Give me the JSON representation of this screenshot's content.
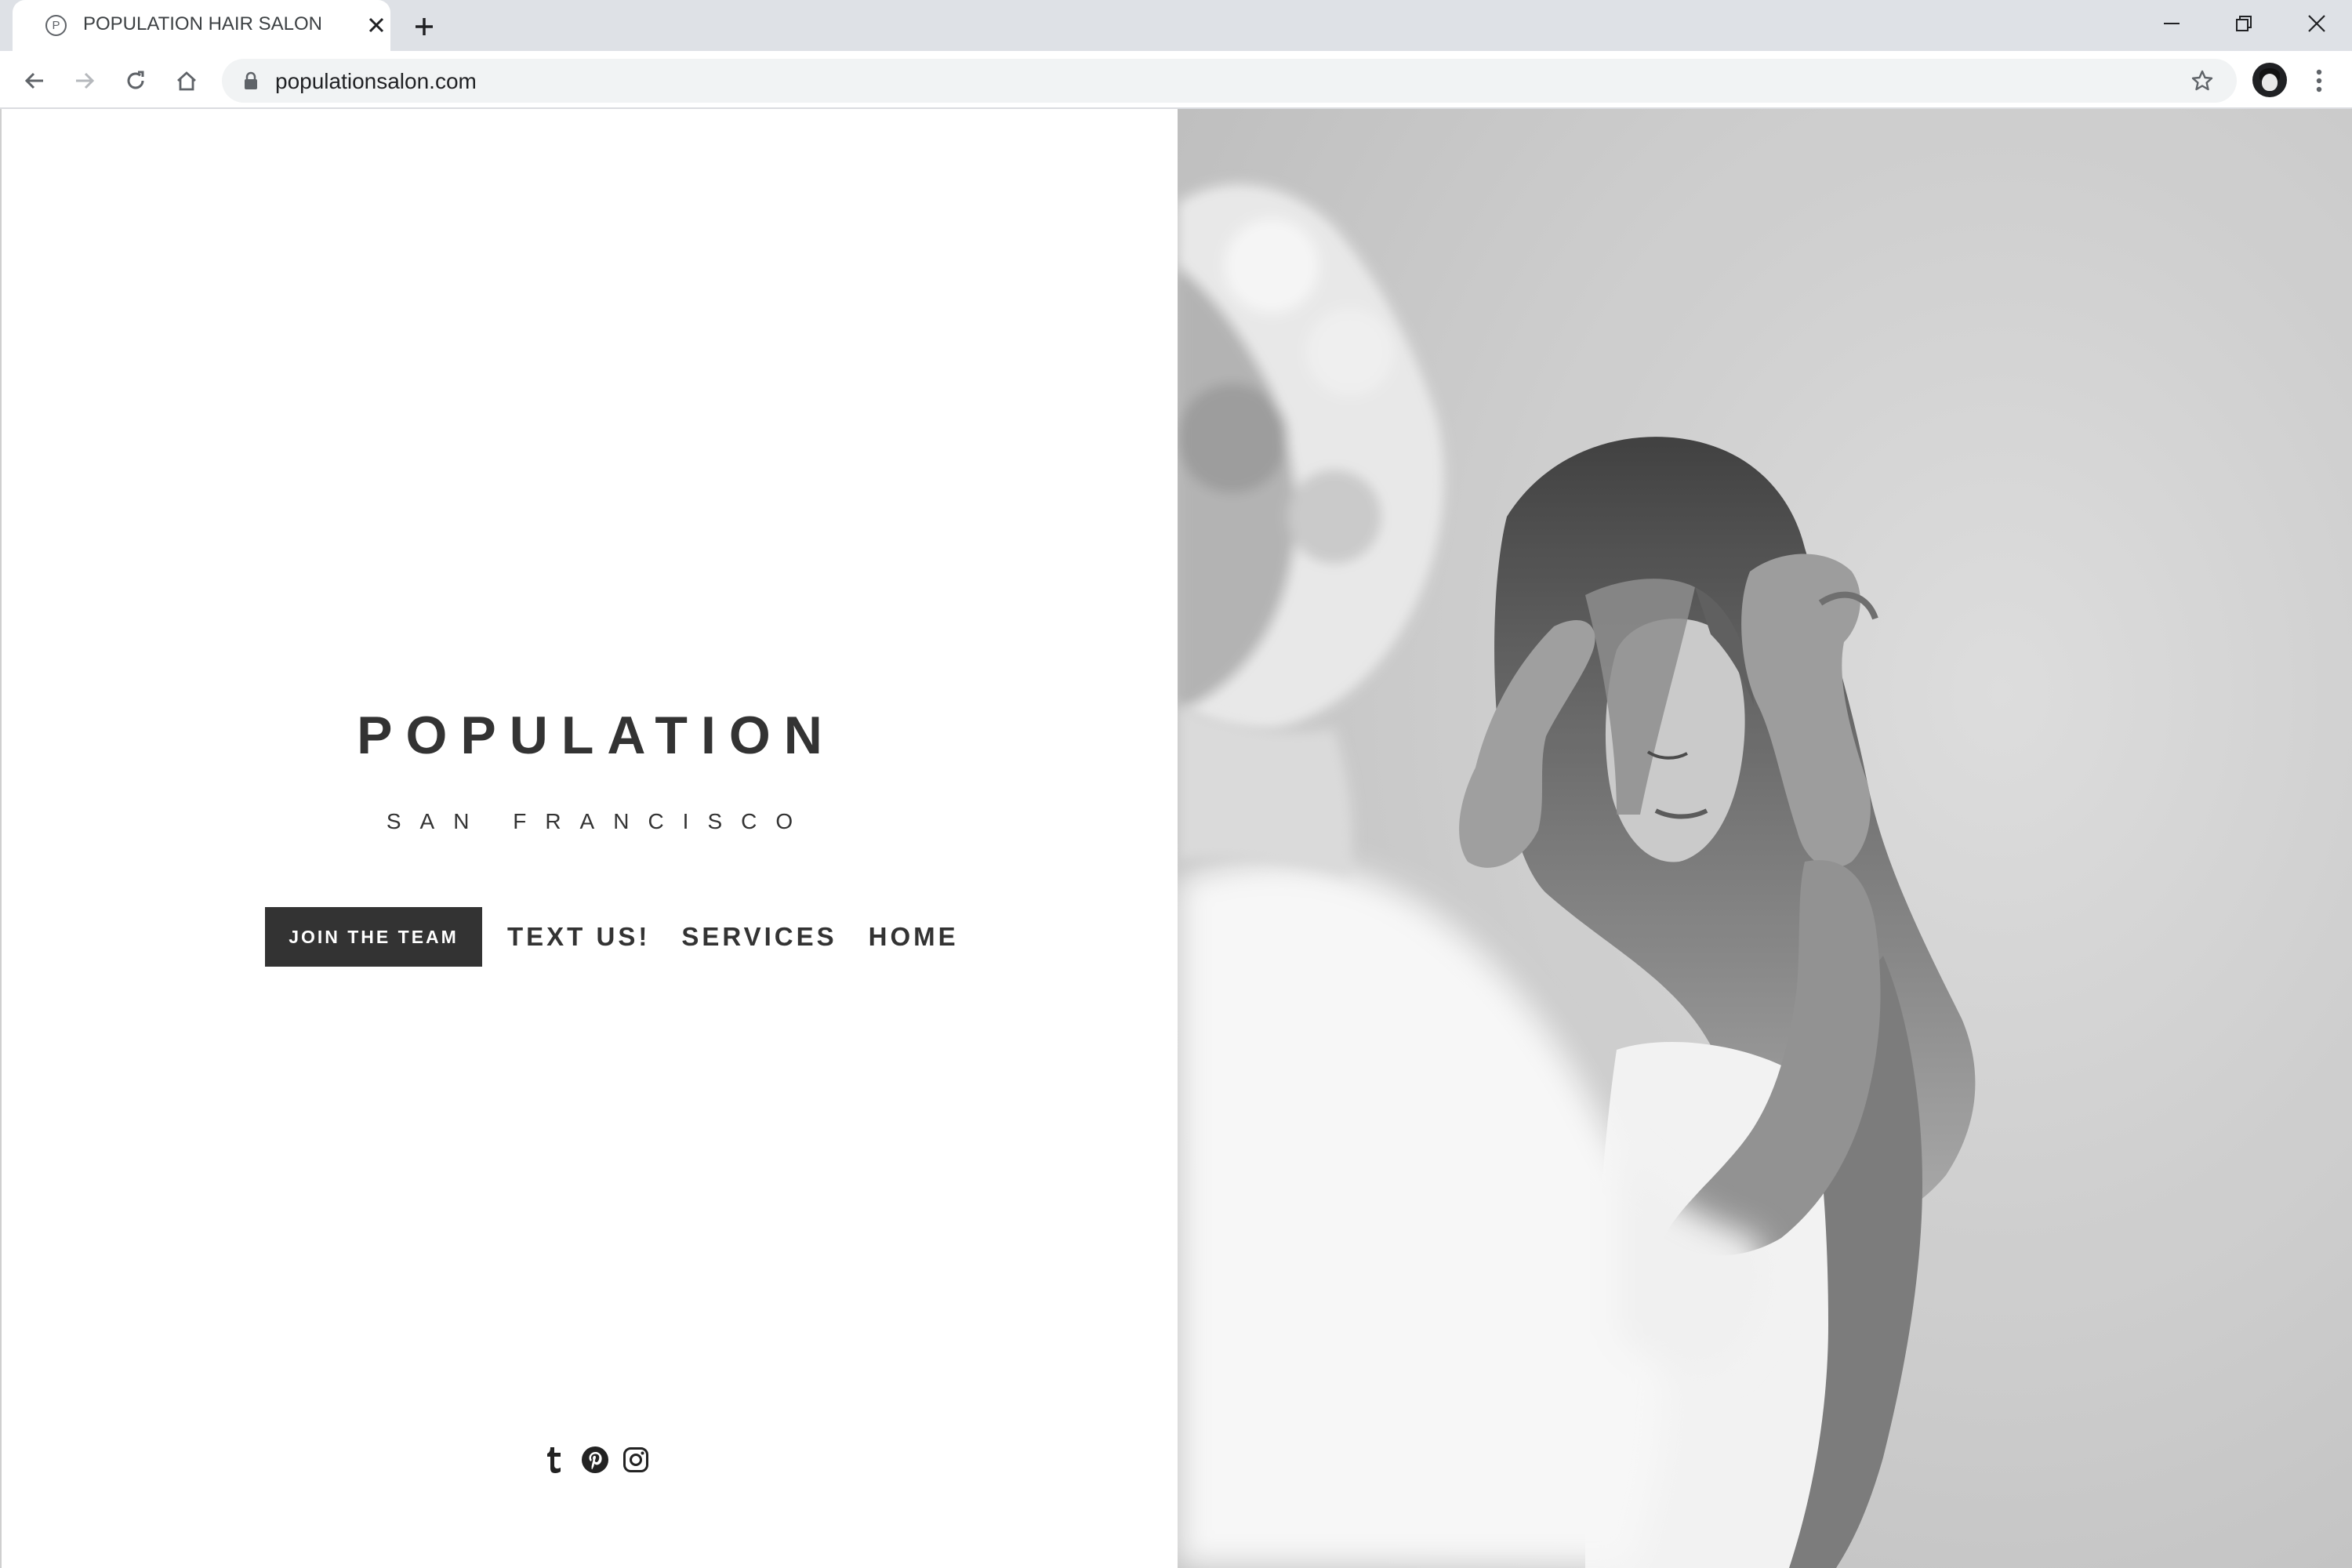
{
  "browser": {
    "tab_title": "POPULATION HAIR SALON",
    "tab_favicon_letter": "P",
    "url": "populationsalon.com"
  },
  "site": {
    "brand": "POPULATION",
    "city": "SAN FRANCISCO",
    "nav": {
      "join": "JOIN THE TEAM",
      "text": "TEXT US!",
      "services": "SERVICES",
      "home": "HOME"
    },
    "social": [
      "tumblr-icon",
      "pinterest-icon",
      "instagram-icon"
    ]
  },
  "colors": {
    "text": "#333333",
    "button_bg": "#333333",
    "tabstrip": "#dee1e6",
    "omnibox": "#f1f3f4"
  }
}
